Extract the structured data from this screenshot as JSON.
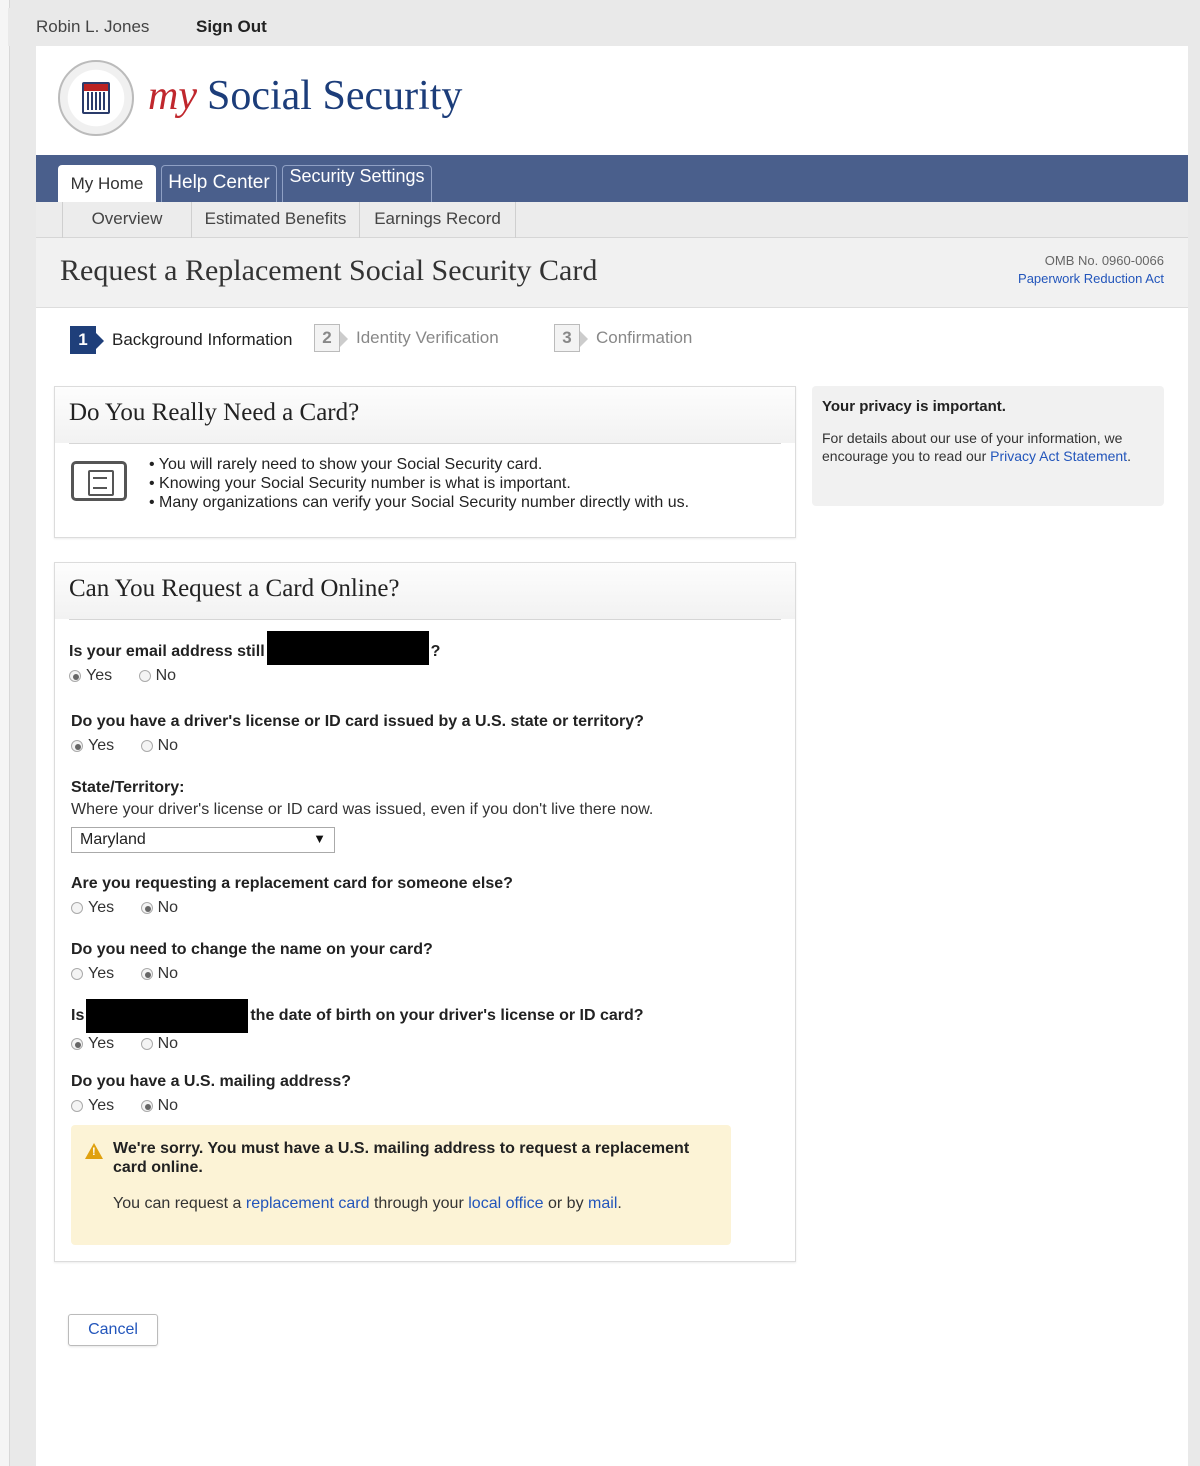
{
  "user": {
    "name": "Robin L. Jones",
    "signout": "Sign Out"
  },
  "brand": {
    "my": "my",
    "name": "Social Security"
  },
  "nav": {
    "tabs": [
      "My Home",
      "Help Center",
      "Security Settings"
    ],
    "subtabs": [
      "Overview",
      "Estimated Benefits",
      "Earnings Record"
    ]
  },
  "title": {
    "text": "Request a Replacement Social Security Card",
    "omb": "OMB No. 0960-0066",
    "pra": "Paperwork Reduction Act"
  },
  "steps": [
    {
      "num": "1",
      "label": "Background Information"
    },
    {
      "num": "2",
      "label": "Identity Verification"
    },
    {
      "num": "3",
      "label": "Confirmation"
    }
  ],
  "panel1": {
    "title": "Do You Really Need a Card?",
    "bullets": [
      "You will rarely need to show your Social Security card.",
      "Knowing your Social Security number is what is important.",
      "Many organizations can verify your Social Security number directly with us."
    ]
  },
  "sidebar": {
    "heading": "Your privacy is important.",
    "text": "For details about our use of your information, we encourage you to read our",
    "link": "Privacy Act Statement",
    "end": "."
  },
  "panel2": {
    "title": "Can You Request a Card Online?",
    "yes": "Yes",
    "no": "No",
    "q1": {
      "pre": "Is your email address still",
      "post": "?"
    },
    "q2": "Do you have a driver's license or ID card issued by a U.S. state or territory?",
    "q3": {
      "label": "State/Territory:",
      "help": "Where your driver's license or ID card was issued, even if you don't live there now.",
      "value": "Maryland"
    },
    "q4": "Are you requesting a replacement card for someone else?",
    "q5": "Do you need to change the name on your card?",
    "q6": {
      "pre": "Is",
      "post": "the date of birth on your driver's license or ID card?"
    },
    "q7": "Do you have a U.S. mailing address?",
    "warning": {
      "title": "We're sorry.  You must have a U.S. mailing address to request a replacement card online.",
      "b1": "You can request a",
      "l1": "replacement card",
      "b2": "through your",
      "l2": "local office",
      "b3": "or by",
      "l3": "mail",
      "b4": "."
    }
  },
  "cancel": "Cancel"
}
